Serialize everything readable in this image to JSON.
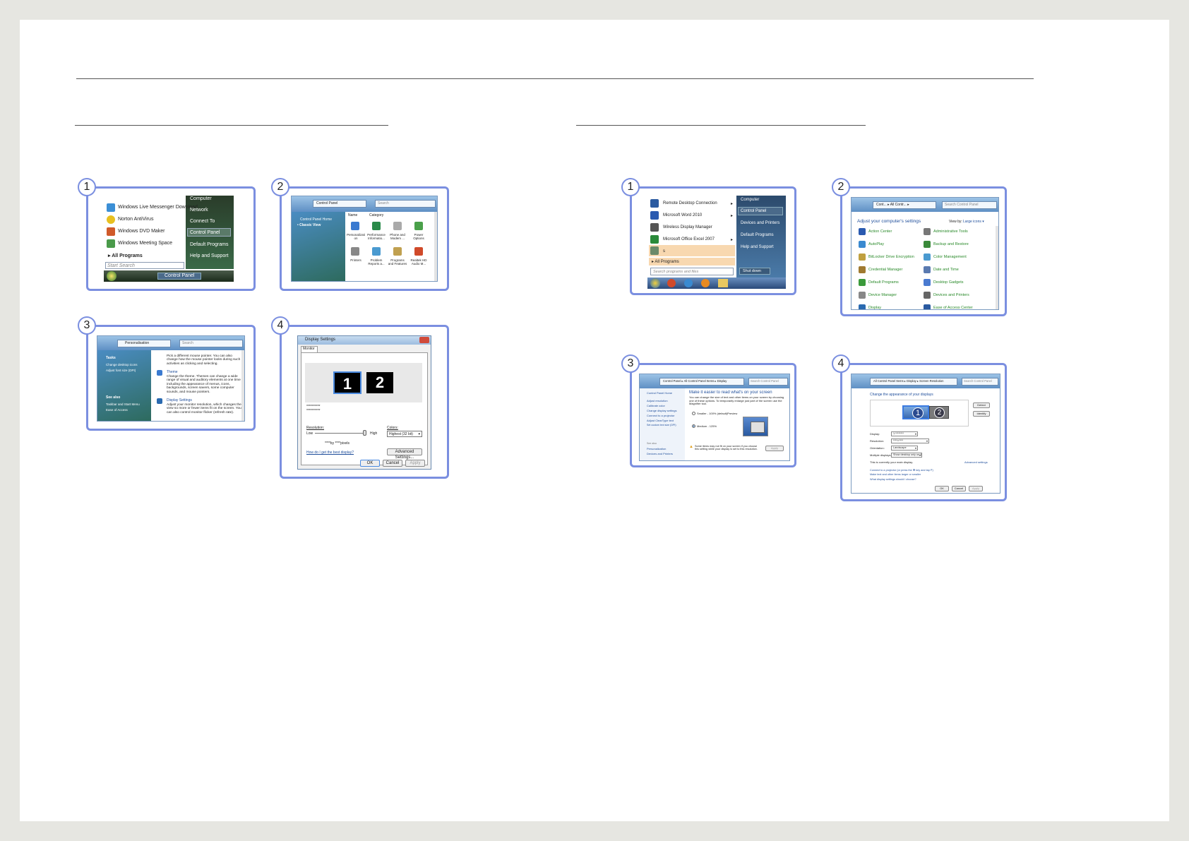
{
  "left": {
    "s1": {
      "items": [
        "Windows Live Messenger Download",
        "Norton AntiVirus",
        "Windows DVD Maker",
        "Windows Meeting Space"
      ],
      "all_programs": "All Programs",
      "search": "Start Search",
      "right": [
        "Computer",
        "Network",
        "Connect To",
        "Control Panel",
        "Default Programs",
        "Help and Support"
      ],
      "taskbar": "Control Panel"
    },
    "s2": {
      "address": "Control Panel",
      "search": "Search",
      "side": [
        "Control Panel Home",
        "Classic View"
      ],
      "cols": [
        "Name",
        "Category"
      ],
      "icons": [
        "Personalizati on",
        "Performance Informatio...",
        "Phone and Modem ...",
        "Power Options",
        "Printers",
        "Problem Reports a...",
        "Programs and Features",
        "Realtek HD Audio M..."
      ]
    },
    "s3": {
      "address": "Personalisation",
      "search": "Search",
      "tasks_title": "Tasks",
      "tasks": [
        "Change desktop icons",
        "Adjust font size (DPI)"
      ],
      "see_also_title": "See also",
      "see_also": [
        "Taskbar and Start Menu",
        "Ease of Access"
      ],
      "p1": "Pick a different mouse pointer. You can also change how the mouse pointer looks during such activities as clicking and selecting.",
      "theme": "Theme",
      "p2": "Change the theme. Themes can change a wide range of visual and auditory elements at one time including the appearance of menus, icons, backgrounds, screen savers, some computer sounds, and mouse pointers.",
      "display": "Display Settings",
      "p3": "Adjust your monitor resolution, which changes the view so more or fewer items fit on the screen. You can also control monitor flicker (refresh rate)."
    },
    "s4": {
      "title": "Display Settings",
      "tab": "Monitor",
      "m1": "1",
      "m2": "2",
      "info1": "**********",
      "info2": "**********",
      "resolution": "Resolution:",
      "low": "Low",
      "high": "High",
      "colors": "Colors:",
      "color_val": "Highest (32 bit)",
      "res_val": "****by ****pixels",
      "link": "How do I get the best display?",
      "advanced": "Advanced Settings...",
      "ok": "OK",
      "cancel": "Cancel",
      "apply": "Apply"
    }
  },
  "right": {
    "s1": {
      "items": [
        "Remote Desktop Connection",
        "Microsoft Word 2010",
        "Wireless Display Manager",
        "Microsoft Office Excel 2007",
        "s"
      ],
      "all_programs": "All Programs",
      "search": "Search programs and files",
      "right": [
        "Computer",
        "Control Panel",
        "Devices and Printers",
        "Default Programs",
        "Help and Support"
      ],
      "shutdown": "Shut down"
    },
    "s2": {
      "address": "Cont... ▸ All Contr... ▸",
      "search": "Search Control Panel",
      "heading": "Adjust your computer's settings",
      "viewby": "View by:",
      "viewval": "Large icons ▾",
      "col1": [
        "Action Center",
        "AutoPlay",
        "BitLocker Drive Encryption",
        "Credential Manager",
        "Default Programs",
        "Device Manager",
        "Display"
      ],
      "col2": [
        "Administrative Tools",
        "Backup and Restore",
        "Color Management",
        "Date and Time",
        "Desktop Gadgets",
        "Devices and Printers",
        "Ease of Access Center"
      ]
    },
    "s3": {
      "address": "Control Panel ▸ All Control Panel Items ▸ Display",
      "search": "Search Control Panel",
      "side": [
        "Control Panel Home",
        "Adjust resolution",
        "Calibrate color",
        "Change display settings",
        "Connect to a projector",
        "Adjust ClearType text",
        "Set custom text size (DPI)"
      ],
      "see_also": [
        "See also",
        "Personalization",
        "Devices and Printers"
      ],
      "heading": "Make it easier to read what's on your screen",
      "desc": "You can change the size of text and other items on your screen by choosing one of these options. To temporarily enlarge just part of the screen use the Magnifier tool.",
      "opt1": "Smaller - 100% (default)",
      "preview": "Preview",
      "opt2": "Medium - 125%",
      "warn": "Some items may not fit on your screen if you choose this setting while your display is set to this resolution.",
      "apply": "Apply"
    },
    "s4": {
      "address": "All Control Panel Items ▸ Display ▸ Screen Resolution",
      "search": "Search Control Panel",
      "heading": "Change the appearance of your displays",
      "m1": "1",
      "m2": "2",
      "detect": "Detect",
      "identify": "Identify",
      "labels": [
        "Display:",
        "Resolution:",
        "Orientation:",
        "Multiple displays:"
      ],
      "values": [
        "1.********",
        "****×****",
        "Landscape",
        "Show desktop only on 1"
      ],
      "main": "This is currently your main display.",
      "advanced": "Advanced settings",
      "links": [
        "Connect to a projector (or press the ❖ key and tap P)",
        "Make text and other items larger or smaller",
        "What display settings should I choose?"
      ],
      "ok": "OK",
      "cancel": "Cancel",
      "apply": "Apply"
    }
  },
  "badges": [
    "1",
    "2",
    "3",
    "4"
  ]
}
